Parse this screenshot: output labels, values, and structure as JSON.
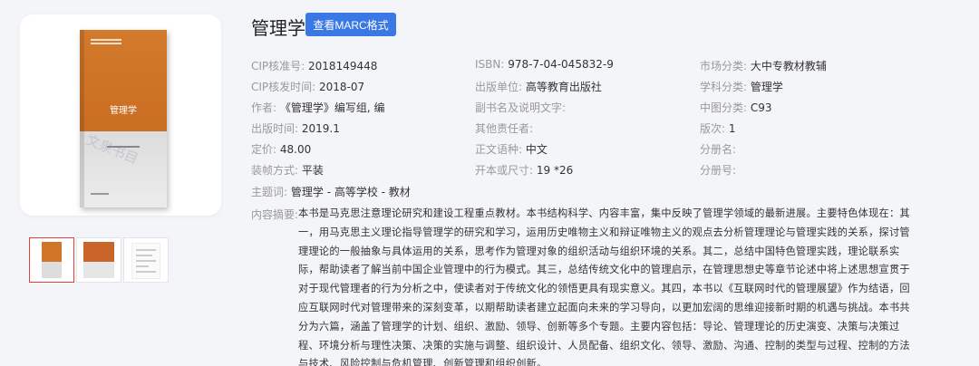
{
  "book": {
    "title": "管理学",
    "cover_title": "管理学",
    "marc_button": "查看MARC格式",
    "watermark": "文泉书目"
  },
  "fields": {
    "cip_no": {
      "label": "CIP核准号:",
      "value": "2018149448"
    },
    "cip_time": {
      "label": "CIP核发时间:",
      "value": "2018-07"
    },
    "author": {
      "label": "作者:",
      "value": "《管理学》编写组, 编"
    },
    "pub_time": {
      "label": "出版时间:",
      "value": "2019.1"
    },
    "price": {
      "label": "定价:",
      "value": "48.00"
    },
    "binding": {
      "label": "装帧方式:",
      "value": "平装"
    },
    "isbn": {
      "label": "ISBN:",
      "value": "978-7-04-045832-9"
    },
    "publisher": {
      "label": "出版单位:",
      "value": "高等教育出版社"
    },
    "parallel_title": {
      "label": "副书名及说明文字:",
      "value": ""
    },
    "other_resp": {
      "label": "其他责任者:",
      "value": ""
    },
    "language": {
      "label": "正文语种:",
      "value": "中文"
    },
    "format": {
      "label": "开本或尺寸:",
      "value": "19 *26"
    },
    "market": {
      "label": "市场分类:",
      "value": "大中专教材教辅"
    },
    "subject_class": {
      "label": "学科分类:",
      "value": "管理学"
    },
    "clc": {
      "label": "中图分类:",
      "value": "C93"
    },
    "edition": {
      "label": "版次:",
      "value": "1"
    },
    "volume_name": {
      "label": "分册名:",
      "value": ""
    },
    "volume_no": {
      "label": "分册号:",
      "value": ""
    },
    "subject_terms": {
      "label": "主题词:",
      "value": "管理学 - 高等学校 - 教材"
    }
  },
  "abstract": {
    "label": "内容摘要:",
    "text": "本书是马克思注意理论研究和建设工程重点教材。本书结构科学、内容丰富，集中反映了管理学领域的最新进展。主要特色体现在：其一，用马克思主义理论指导管理学的研究和学习，运用历史唯物主义和辩证唯物主义的观点去分析管理理论与管理实践的关系，探讨管理理论的一般抽象与具体运用的关系，思考作为管理对象的组织活动与组织环境的关系。其二，总结中国特色管理实践，理论联系实际，帮助读者了解当前中国企业管理中的行为模式。其三，总结传统文化中的管理启示，在管理思想史等章节论述中将上述思想宣贯于对于现代管理者的行为分析之中，使读者对于传统文化的领悟更具有现实意义。其四，本书以《互联网时代的管理展望》作为结语，回应互联网时代对管理带来的深刻变革，以期帮助读者建立起面向未来的学习导向，以更加宏阔的思维迎接新时期的机遇与挑战。本书共分为六篇，涵盖了管理学的计划、组织、激励、领导、创新等多个专题。主要内容包括：导论、管理理论的历史演变、决策与决策过程、环境分析与理性决策、决策的实施与调整、组织设计、人员配备、组织文化、领导、激励、沟通、控制的类型与过程、控制的方法与技术、风险控制与危机管理、创新管理和组织创新。"
  },
  "colors": {
    "accent": "#3a78e6",
    "cover_orange": "#d07427",
    "thumb_active_border": "#e34040"
  }
}
